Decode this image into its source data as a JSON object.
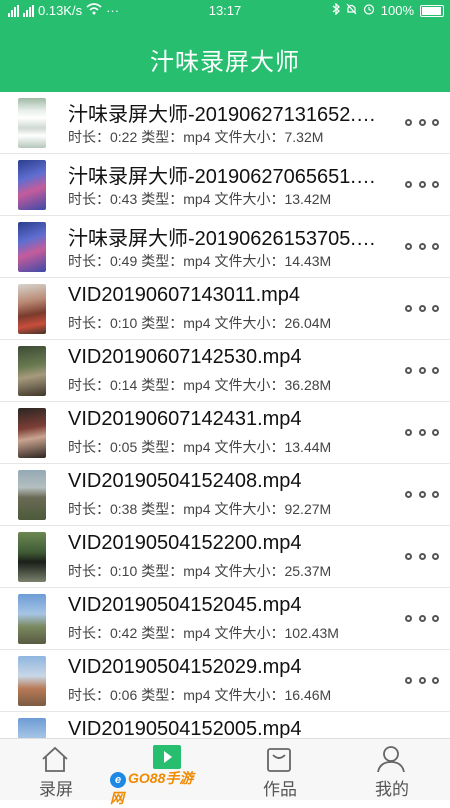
{
  "status_bar": {
    "network_speed": "0.13K/s",
    "time": "13:17",
    "battery": "100%",
    "carrier_label": "4G"
  },
  "app": {
    "title": "汁味录屏大师"
  },
  "videos": [
    {
      "name": "汁味录屏大师-20190627131652.…",
      "duration": "时长：0:22",
      "type": "类型：mp4",
      "size": "文件大小：7.32M",
      "thumb": "phone-screenshot-light"
    },
    {
      "name": "汁味录屏大师-20190627065651.…",
      "duration": "时长：0:43",
      "type": "类型：mp4",
      "size": "文件大小：13.42M",
      "thumb": "phone-homescreen"
    },
    {
      "name": "汁味录屏大师-20190626153705.…",
      "duration": "时长：0:49",
      "type": "类型：mp4",
      "size": "文件大小：14.43M",
      "thumb": "phone-homescreen"
    },
    {
      "name": "VID20190607143011.mp4",
      "duration": "时长：0:10",
      "type": "类型：mp4",
      "size": "文件大小：26.04M",
      "thumb": "people-red"
    },
    {
      "name": "VID20190607142530.mp4",
      "duration": "时长：0:14",
      "type": "类型：mp4",
      "size": "文件大小：36.28M",
      "thumb": "people-green"
    },
    {
      "name": "VID20190607142431.mp4",
      "duration": "时长：0:05",
      "type": "类型：mp4",
      "size": "文件大小：13.44M",
      "thumb": "people-dark"
    },
    {
      "name": "VID20190504152408.mp4",
      "duration": "时长：0:38",
      "type": "类型：mp4",
      "size": "文件大小：92.27M",
      "thumb": "outdoor-structure"
    },
    {
      "name": "VID20190504152200.mp4",
      "duration": "时长：0:10",
      "type": "类型：mp4",
      "size": "文件大小：25.37M",
      "thumb": "outdoor-tire"
    },
    {
      "name": "VID20190504152045.mp4",
      "duration": "时长：0:42",
      "type": "类型：mp4",
      "size": "文件大小：102.43M",
      "thumb": "outdoor-sky"
    },
    {
      "name": "VID20190504152029.mp4",
      "duration": "时长：0:06",
      "type": "类型：mp4",
      "size": "文件大小：16.46M",
      "thumb": "outdoor-spiral"
    },
    {
      "name": "VID20190504152005.mp4",
      "duration": "",
      "type": "",
      "size": "",
      "thumb": "outdoor-sky"
    }
  ],
  "tabs": [
    {
      "label": "录屏",
      "icon": "home-icon",
      "active": false
    },
    {
      "label": "",
      "icon": "play-icon",
      "active": true
    },
    {
      "label": "作品",
      "icon": "folder-icon",
      "active": false
    },
    {
      "label": "我的",
      "icon": "person-icon",
      "active": false
    }
  ],
  "watermark": "GO88手游网",
  "colors": {
    "accent": "#27bf6f",
    "text": "#111111",
    "meta": "#444444"
  }
}
